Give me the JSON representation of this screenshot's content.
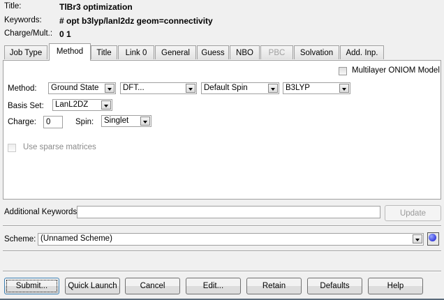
{
  "header": {
    "title_label": "Title:",
    "title_value": "TlBr3 optimization",
    "keywords_label": "Keywords:",
    "keywords_value": "# opt b3lyp/lanl2dz geom=connectivity",
    "charge_label": "Charge/Mult.:",
    "charge_value": "0 1"
  },
  "tabs": [
    {
      "label": "Job Type"
    },
    {
      "label": "Method",
      "selected": true
    },
    {
      "label": "Title"
    },
    {
      "label": "Link 0"
    },
    {
      "label": "General"
    },
    {
      "label": "Guess"
    },
    {
      "label": "NBO"
    },
    {
      "label": "PBC",
      "disabled": true
    },
    {
      "label": "Solvation"
    },
    {
      "label": "Add. Inp."
    }
  ],
  "method_tab": {
    "oniom_label": "Multilayer ONIOM Model",
    "oniom_checked": false,
    "method_label": "Method:",
    "state": "Ground State",
    "method_type": "DFT...",
    "spin_mode": "Default Spin",
    "functional": "B3LYP",
    "basis_label": "Basis Set:",
    "basis": "LanL2DZ",
    "charge_label": "Charge:",
    "charge": "0",
    "spin_label": "Spin:",
    "spin": "Singlet",
    "sparse_label": "Use sparse matrices",
    "sparse_checked": false,
    "sparse_disabled": true
  },
  "additional": {
    "label": "Additional Keywords:",
    "value": "",
    "update": "Update"
  },
  "scheme": {
    "label": "Scheme:",
    "value": "(Unnamed Scheme)"
  },
  "buttons": [
    "Submit...",
    "Quick Launch",
    "Cancel",
    "Edit...",
    "Retain",
    "Defaults",
    "Help"
  ]
}
